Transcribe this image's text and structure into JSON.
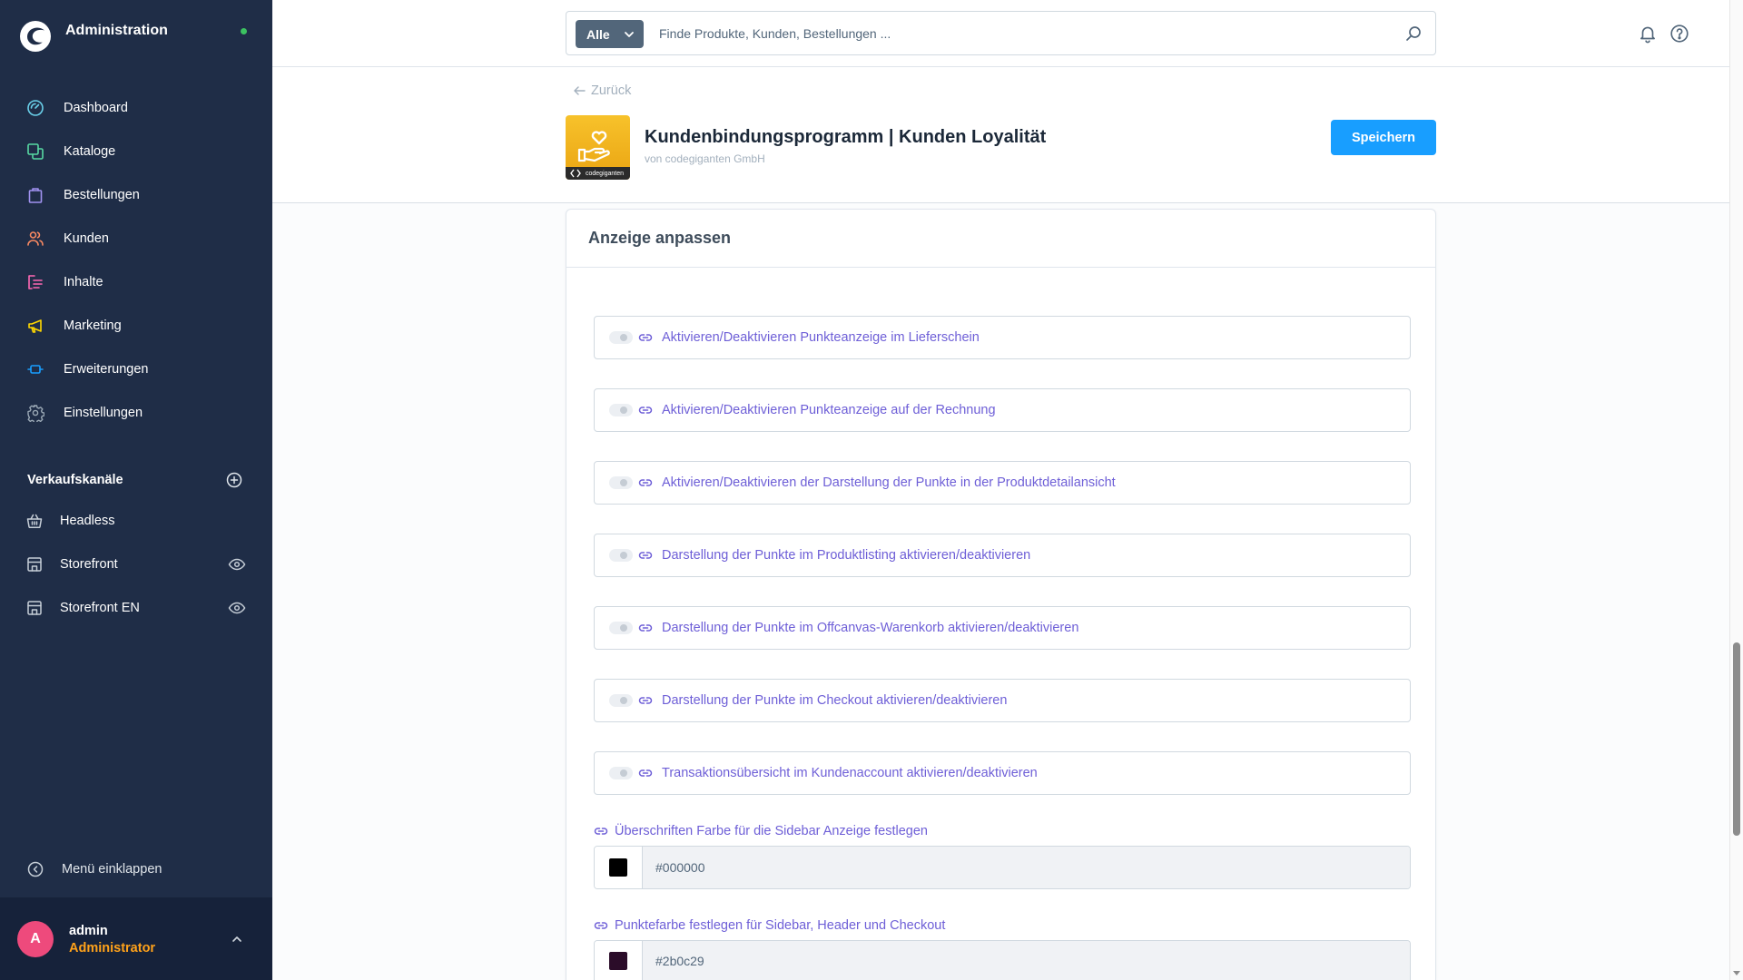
{
  "app": {
    "title": "Administration",
    "status_color": "#3cc261",
    "logo_icon": "shopware-logo-icon"
  },
  "sidebar": {
    "nav": [
      {
        "label": "Dashboard",
        "icon": "dashboard-icon",
        "color": "#6ad0ea"
      },
      {
        "label": "Kataloge",
        "icon": "catalog-icon",
        "color": "#57d9a3"
      },
      {
        "label": "Bestellungen",
        "icon": "orders-icon",
        "color": "#a092f0"
      },
      {
        "label": "Kunden",
        "icon": "customers-icon",
        "color": "#f88962"
      },
      {
        "label": "Inhalte",
        "icon": "content-icon",
        "color": "#ff68b4"
      },
      {
        "label": "Marketing",
        "icon": "marketing-icon",
        "color": "#ffd700"
      },
      {
        "label": "Erweiterungen",
        "icon": "extensions-icon",
        "color": "#189eff"
      },
      {
        "label": "Einstellungen",
        "icon": "settings-icon",
        "color": "#9aa8b5"
      }
    ],
    "sales_channels": {
      "title": "Verkaufskanäle",
      "add_icon": "plus-circle-icon",
      "items": [
        {
          "label": "Headless",
          "icon": "basket-icon"
        },
        {
          "label": "Storefront",
          "icon": "storefront-icon",
          "visibility_icon": "eye-icon"
        },
        {
          "label": "Storefront EN",
          "icon": "storefront-icon",
          "visibility_icon": "eye-icon"
        }
      ]
    },
    "collapse_label": "Menü einklappen",
    "user": {
      "initial": "A",
      "name": "admin",
      "role": "Administrator",
      "avatar_color": "#ee4a7c",
      "role_color": "#ffa21a"
    }
  },
  "topbar": {
    "search": {
      "filter_label": "Alle",
      "placeholder": "Finde Produkte, Kunden, Bestellungen ...",
      "icon": "search-icon"
    },
    "icons": [
      "bell-icon",
      "help-icon"
    ]
  },
  "page": {
    "back_label": "Zurück",
    "title": "Kundenbindungsprogramm | Kunden Loyalität",
    "vendor": "von codegiganten GmbH",
    "logo_text": "codegiganten",
    "save_label": "Speichern",
    "accent_color": "#189eff"
  },
  "card": {
    "title": "Anzeige anpassen",
    "label_color": "#6e5fd7",
    "toggles": [
      {
        "label": "Aktivieren/Deaktivieren Punkteanzeige im Lieferschein",
        "checked": false
      },
      {
        "label": "Aktivieren/Deaktivieren Punkteanzeige auf der Rechnung",
        "checked": false
      },
      {
        "label": "Aktivieren/Deaktivieren der Darstellung der Punkte in der Produktdetailansicht",
        "checked": false
      },
      {
        "label": "Darstellung der Punkte im Produktlisting aktivieren/deaktivieren",
        "checked": false
      },
      {
        "label": "Darstellung der Punkte im Offcanvas-Warenkorb aktivieren/deaktivieren",
        "checked": false
      },
      {
        "label": "Darstellung der Punkte im Checkout aktivieren/deaktivieren",
        "checked": false
      },
      {
        "label": "Transaktionsübersicht im Kundenaccount aktivieren/deaktivieren",
        "checked": false
      }
    ],
    "color_fields": [
      {
        "label": "Überschriften Farbe für die Sidebar Anzeige festlegen",
        "value": "#000000"
      },
      {
        "label": "Punktefarbe festlegen für Sidebar, Header und Checkout",
        "value": "#2b0c29"
      }
    ]
  }
}
